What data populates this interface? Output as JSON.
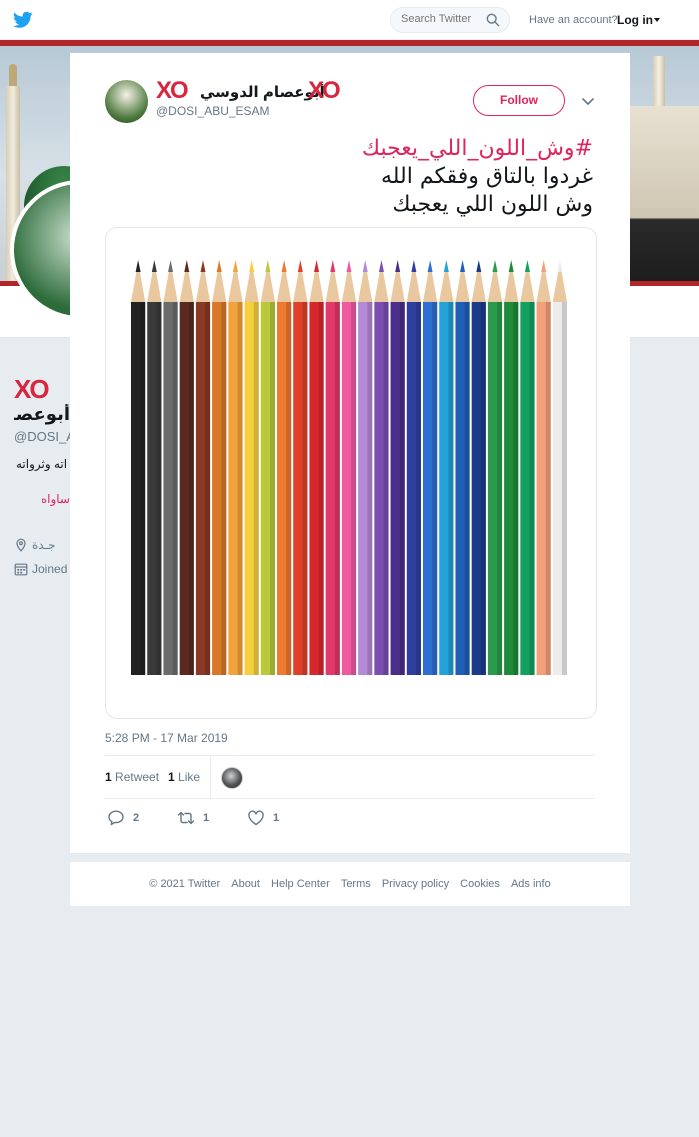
{
  "topbar": {
    "search_placeholder": "Search Twitter",
    "have_account": "Have an account?",
    "login_label": "Log in"
  },
  "profile": {
    "xo": "XO",
    "name": "أبوعصام الدوسي",
    "handle": "@DOSI_ABU_ESAM",
    "bio_fragment": "اته وثرواته",
    "link_fragment": "ساواه",
    "location": "جـدة",
    "joined_label": "Joined"
  },
  "tweet": {
    "author_xo_left": "XO",
    "author_name": "أبوعصام الدوسي",
    "author_xo_right": "XO",
    "author_handle": "@DOSI_ABU_ESAM",
    "follow_label": "Follow",
    "hashtag": "#وش_اللون_اللي_يعجبك",
    "line1": "غردوا بالتاق وفقكم الله",
    "line2": "وش اللون اللي يعجبك",
    "timestamp": "5:28 PM - 17 Mar 2019",
    "retweet_count": "1",
    "retweet_label": "Retweet",
    "like_count": "1",
    "like_label": "Like",
    "reply_action_count": "2",
    "retweet_action_count": "1",
    "like_action_count": "1"
  },
  "pencil_colors": [
    "#222222",
    "#3a3a3a",
    "#6b6b6b",
    "#5a2a20",
    "#8a3a24",
    "#d9782a",
    "#f2a23a",
    "#f4d03f",
    "#b9c93a",
    "#ee7a30",
    "#e0402a",
    "#d8262e",
    "#e2386a",
    "#ee5aa0",
    "#b58ad4",
    "#7a4fb0",
    "#4b2e8a",
    "#2f3fa0",
    "#2e6fd0",
    "#23a2d8",
    "#1f5fb8",
    "#1b3a8a",
    "#2b9a4a",
    "#1f8a3a",
    "#13a060",
    "#f2a07a",
    "#ececec"
  ],
  "footer": {
    "copyright": "© 2021 Twitter",
    "about": "About",
    "help": "Help Center",
    "terms": "Terms",
    "privacy": "Privacy policy",
    "cookies": "Cookies",
    "ads": "Ads info"
  }
}
